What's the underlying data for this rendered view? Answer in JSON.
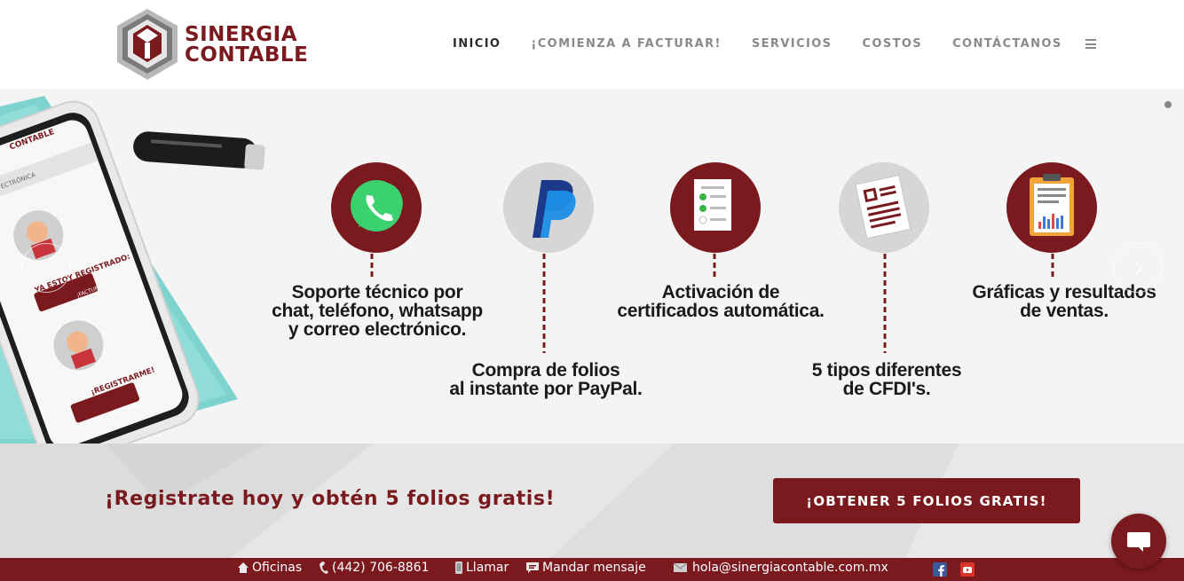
{
  "brand": {
    "line1": "SINERGIA",
    "line2": "CONTABLE",
    "color": "#7a1a1f"
  },
  "nav": {
    "items": [
      {
        "label": "INICIO",
        "active": true
      },
      {
        "label": "¡COMIENZA A FACTURAR!",
        "active": false
      },
      {
        "label": "SERVICIOS",
        "active": false
      },
      {
        "label": "COSTOS",
        "active": false
      },
      {
        "label": "CONTÁCTANOS",
        "active": false
      }
    ],
    "menu_icon": "hamburger-icon"
  },
  "hero": {
    "phone": {
      "brand_small": "CONTABLE",
      "section": "ECTRÓNICA",
      "registered_text": "YA ESTOY REGISTRADO:",
      "facturar_btn": "¡FACTURAR!",
      "register_text": "¡REGISTRARME!",
      "register_btn": "¡REGISTRARME!"
    },
    "features": [
      {
        "icon": "whatsapp-icon",
        "label_lines": [
          "Soporte técnico por",
          "chat, teléfono, whatsapp",
          "y correo electrónico."
        ]
      },
      {
        "icon": "paypal-icon",
        "label_lines": [
          "Compra de folios",
          "al instante por PayPal."
        ]
      },
      {
        "icon": "checklist-icon",
        "label_lines": [
          "Activación de",
          "certificados automática."
        ]
      },
      {
        "icon": "documents-icon",
        "label_lines": [
          "5 tipos diferentes",
          "de CFDI's."
        ]
      },
      {
        "icon": "report-chart-icon",
        "label_lines": [
          "Gráficas y resultados",
          "de ventas."
        ]
      }
    ]
  },
  "cta": {
    "text": "¡Registrate hoy y obtén 5 folios gratis!",
    "button": "¡OBTENER 5 FOLIOS GRATIS!"
  },
  "chat": {
    "icon": "chat-bubble-icon"
  },
  "footer": {
    "office": "Oficinas",
    "phone": "(442) 706-8861",
    "call": "Llamar",
    "message": "Mandar mensaje",
    "email": "hola@sinergiacontable.com.mx",
    "social": [
      "facebook-icon",
      "youtube-icon"
    ]
  },
  "colors": {
    "maroon": "#7a1a1f",
    "gray_circle": "#d6d6d6",
    "teal": "#7fd3cf"
  }
}
